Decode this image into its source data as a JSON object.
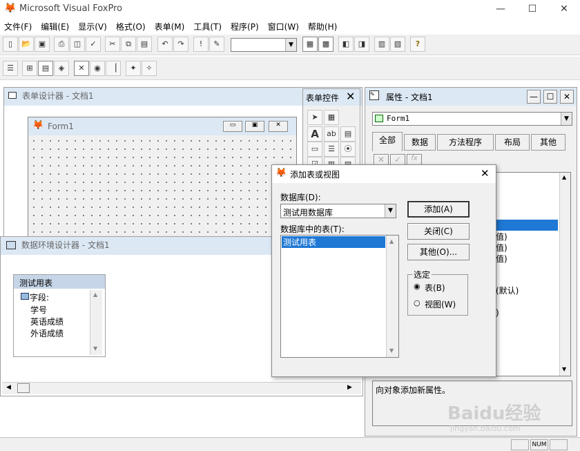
{
  "app": {
    "title": "Microsoft Visual FoxPro"
  },
  "menu": [
    "文件(F)",
    "编辑(E)",
    "显示(V)",
    "格式(O)",
    "表单(M)",
    "工具(T)",
    "程序(P)",
    "窗口(W)",
    "帮助(H)"
  ],
  "form_designer": {
    "title": "表单设计器 - 文档1",
    "form_title": "Form1"
  },
  "form_controls": {
    "title": "表单控件"
  },
  "properties": {
    "title": "属性 - 文档1",
    "object": "Form1",
    "tabs": [
      "全部",
      "数据",
      "方法程序",
      "布局",
      "其他"
    ],
    "partial_values": [
      "值)",
      "值)",
      "值)",
      "(默认)",
      ")"
    ],
    "description": "向对象添加新属性。"
  },
  "data_env": {
    "title": "数据环境设计器 - 文档1",
    "table": "测试用表",
    "fields_label": "字段:",
    "fields": [
      "学号",
      "英语成绩",
      "外语成绩"
    ]
  },
  "dialog": {
    "title": "添加表或视图",
    "database_label": "数据库(D):",
    "database_value": "测试用数据库",
    "tables_label": "数据库中的表(T):",
    "tables": [
      "测试用表"
    ],
    "add": "添加(A)",
    "close": "关闭(C)",
    "other": "其他(O)...",
    "select_group": "选定",
    "opt_table": "表(B)",
    "opt_view": "视图(W)"
  },
  "status": {
    "num": "NUM"
  },
  "watermark": {
    "brand": "Baidu经验",
    "url": "jingyan.baidu.com"
  }
}
